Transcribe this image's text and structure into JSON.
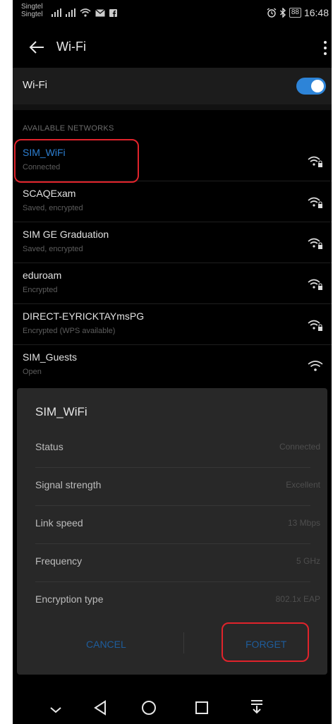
{
  "statusbar": {
    "carrier_line1": "Singtel",
    "carrier_line2": "Singtel",
    "battery": "88",
    "time": "16:48"
  },
  "toolbar": {
    "title": "Wi-Fi"
  },
  "wifi_toggle": {
    "label": "Wi-Fi",
    "enabled": true
  },
  "section_header": "AVAILABLE NETWORKS",
  "networks": [
    {
      "name": "SIM_WiFi",
      "status": "Connected"
    },
    {
      "name": "SCAQExam",
      "status": "Saved, encrypted"
    },
    {
      "name": "SIM GE Graduation",
      "status": "Saved, encrypted"
    },
    {
      "name": "eduroam",
      "status": "Encrypted"
    },
    {
      "name": "DIRECT-EYRICKTAYmsPG",
      "status": "Encrypted (WPS available)"
    },
    {
      "name": "SIM_Guests",
      "status": "Open"
    }
  ],
  "dialog": {
    "title": "SIM_WiFi",
    "rows": [
      {
        "key": "Status",
        "value": "Connected"
      },
      {
        "key": "Signal strength",
        "value": "Excellent"
      },
      {
        "key": "Link speed",
        "value": "13 Mbps"
      },
      {
        "key": "Frequency",
        "value": "5 GHz"
      },
      {
        "key": "Encryption type",
        "value": "802.1x EAP"
      }
    ],
    "cancel_label": "CANCEL",
    "forget_label": "FORGET"
  },
  "colors": {
    "accent": "#2d84d8",
    "highlight": "#e0232b"
  }
}
